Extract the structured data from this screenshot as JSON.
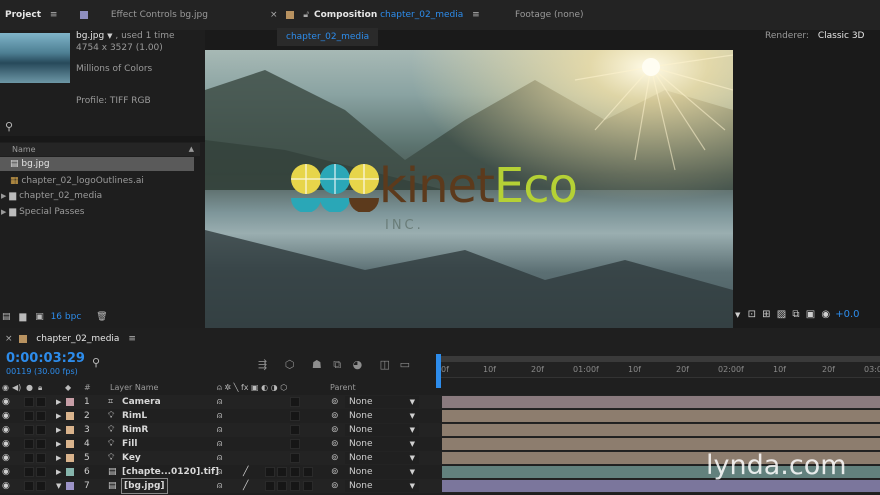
{
  "panels": {
    "project_tab": "Project",
    "effect_controls_tab": "Effect Controls bg.jpg",
    "composition_tab_prefix": "Composition",
    "composition_tab_name": "chapter_02_media",
    "footage_tab": "Footage (none)",
    "comp_subtab": "chapter_02_media",
    "renderer_label": "Renderer:",
    "renderer_value": "Classic 3D"
  },
  "project": {
    "filename": "bg.jpg",
    "used": ", used 1 time",
    "dimensions": "4754 x 3527 (1.00)",
    "colors": "Millions of Colors",
    "profile": "Profile: TIFF RGB",
    "column_name": "Name",
    "items": [
      {
        "name": "bg.jpg"
      },
      {
        "name": "chapter_02_logoOutlines.ai"
      },
      {
        "name": "chapter_02_media"
      },
      {
        "name": "Special Passes"
      }
    ],
    "bpc": "16 bpc"
  },
  "viewer": {
    "logo_text_a": "kinet",
    "logo_text_b": "Eco",
    "logo_inc": "INC.",
    "exposure": "+0.0"
  },
  "timeline": {
    "tab": "chapter_02_media",
    "timecode": "0:00:03:29",
    "frames": "00119 (30.00 fps)",
    "header_hash": "#",
    "header_layer": "Layer Name",
    "header_parent": "Parent",
    "ruler": [
      "0f",
      "10f",
      "20f",
      "01:00f",
      "10f",
      "20f",
      "02:00f",
      "10f",
      "20f",
      "03:0"
    ],
    "layers": [
      {
        "num": "1",
        "name": "Camera",
        "parent": "None",
        "color": "#c79ea6",
        "bar": "#8a7a7e"
      },
      {
        "num": "2",
        "name": "RimL",
        "parent": "None",
        "color": "#d9b38c",
        "bar": "#8d7d6e"
      },
      {
        "num": "3",
        "name": "RimR",
        "parent": "None",
        "color": "#d9b38c",
        "bar": "#8d7d6e"
      },
      {
        "num": "4",
        "name": "Fill",
        "parent": "None",
        "color": "#d9b38c",
        "bar": "#8d7d6e"
      },
      {
        "num": "5",
        "name": "Key",
        "parent": "None",
        "color": "#d9b38c",
        "bar": "#8d7d6e"
      },
      {
        "num": "6",
        "name": "[chapte...0120].tif]",
        "parent": "None",
        "color": "#86b5ac",
        "bar": "#62817d"
      },
      {
        "num": "7",
        "name": "[bg.jpg]",
        "parent": "None",
        "color": "#9c93c7",
        "bar": "#7b769c"
      }
    ]
  },
  "watermark": "lynda.com",
  "colors": {
    "accent": "#2d8ceb",
    "logo_teal": "#2aa7b7",
    "logo_yellow": "#e7d54a",
    "logo_brown": "#5c3a1c",
    "logo_green": "#b5d135"
  }
}
